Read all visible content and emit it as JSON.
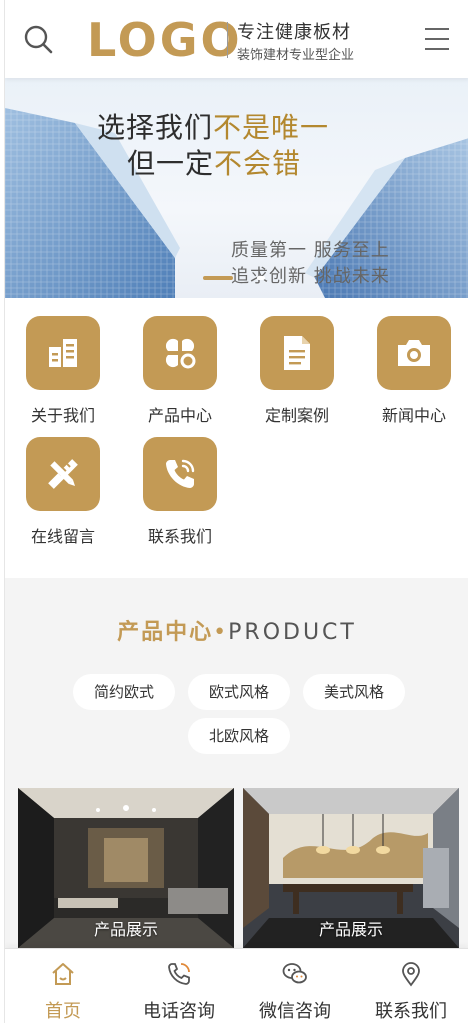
{
  "header": {
    "logo_text": "LOGO",
    "title": "专注健康板材",
    "subtitle": "装饰建材专业型企业"
  },
  "banner": {
    "line1_a": "选择我们",
    "line1_b": "不是唯一",
    "line2_a": "但一定",
    "line2_b": "不会错",
    "slogan1": "质量第一 服务至上",
    "slogan2": "追求创新 挑战未来"
  },
  "nav": {
    "items": [
      {
        "label": "关于我们",
        "icon": "building-icon"
      },
      {
        "label": "产品中心",
        "icon": "clover-icon"
      },
      {
        "label": "定制案例",
        "icon": "document-icon"
      },
      {
        "label": "新闻中心",
        "icon": "camera-icon"
      },
      {
        "label": "在线留言",
        "icon": "pencil-ruler-icon"
      },
      {
        "label": "联系我们",
        "icon": "phone-icon"
      }
    ]
  },
  "product_section": {
    "title_cn": "产品中心",
    "title_dot": "•",
    "title_en": "PRODUCT",
    "tags": [
      "简约欧式",
      "欧式风格",
      "美式风格",
      "北欧风格"
    ],
    "cards": [
      {
        "label": "产品展示"
      },
      {
        "label": "产品展示"
      }
    ]
  },
  "bottom_bar": {
    "tabs": [
      {
        "label": "首页",
        "icon": "home-icon",
        "active": true
      },
      {
        "label": "电话咨询",
        "icon": "phone-icon"
      },
      {
        "label": "微信咨询",
        "icon": "wechat-icon"
      },
      {
        "label": "联系我们",
        "icon": "location-icon"
      }
    ]
  },
  "colors": {
    "accent": "#c39a55",
    "text": "#333333",
    "section_bg": "#f4f4f4"
  }
}
